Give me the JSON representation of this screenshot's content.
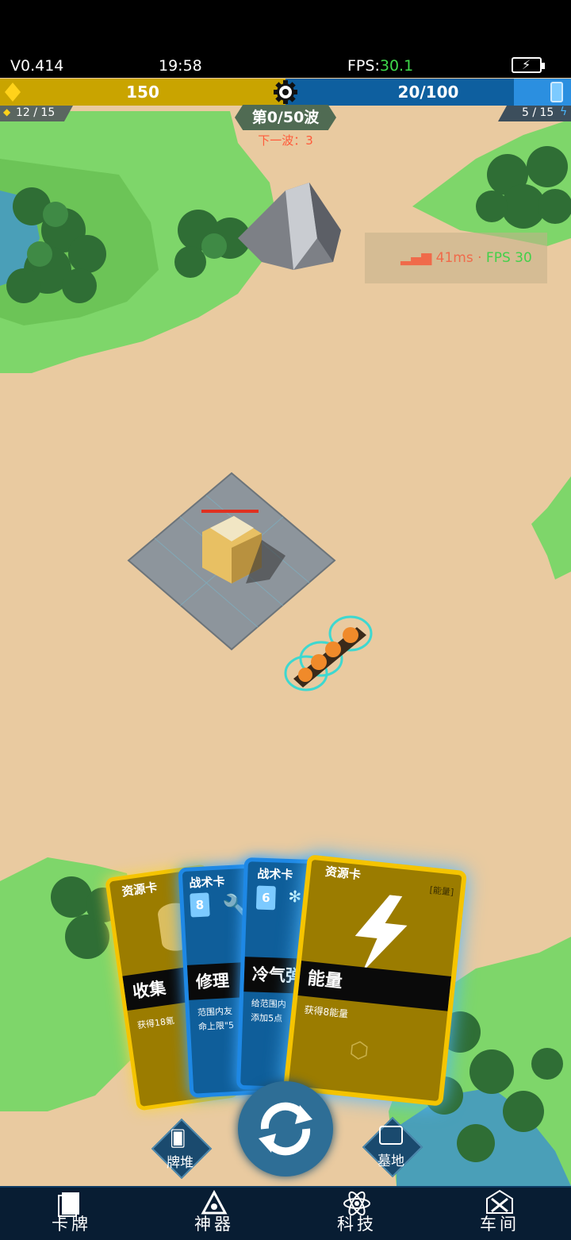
{
  "status": {
    "version": "V0.414",
    "time": "19:58",
    "fps_label": "FPS:",
    "fps_value": "30.1"
  },
  "resources": {
    "gold": "150",
    "energy": "20/100",
    "gold_capacity": "12 / 15",
    "energy_capacity": "5 / 15"
  },
  "wave": {
    "title": "第0/50波",
    "next": "下一波：3"
  },
  "overlay": {
    "ping": "41ms",
    "fps": "FPS 30"
  },
  "cards": [
    {
      "type": "资源卡",
      "name": "收集",
      "desc": "获得18氪"
    },
    {
      "type": "战术卡",
      "cost": "8",
      "name": "修理",
      "desc1": "范围内友",
      "desc2": "命上限\"5"
    },
    {
      "type": "战术卡",
      "cost": "6",
      "name": "冷气弹",
      "desc1": "给范围内",
      "desc2": "添加5点"
    },
    {
      "type": "资源卡",
      "tag": "[能量]",
      "name": "能量",
      "desc": "获得8能量"
    }
  ],
  "actions": {
    "deck": "牌堆",
    "graveyard": "墓地"
  },
  "nav": [
    {
      "label": "卡牌",
      "icon": "card-icon"
    },
    {
      "label": "神器",
      "icon": "artifact-icon"
    },
    {
      "label": "科技",
      "icon": "atom-icon"
    },
    {
      "label": "车间",
      "icon": "workshop-icon"
    }
  ],
  "colors": {
    "gold": "#c9a400",
    "energy": "#0e5f9f",
    "grass": "#7ed66a",
    "sand": "#e9caa0",
    "card_blue": "#1e88e5",
    "card_gold": "#f5c400"
  }
}
